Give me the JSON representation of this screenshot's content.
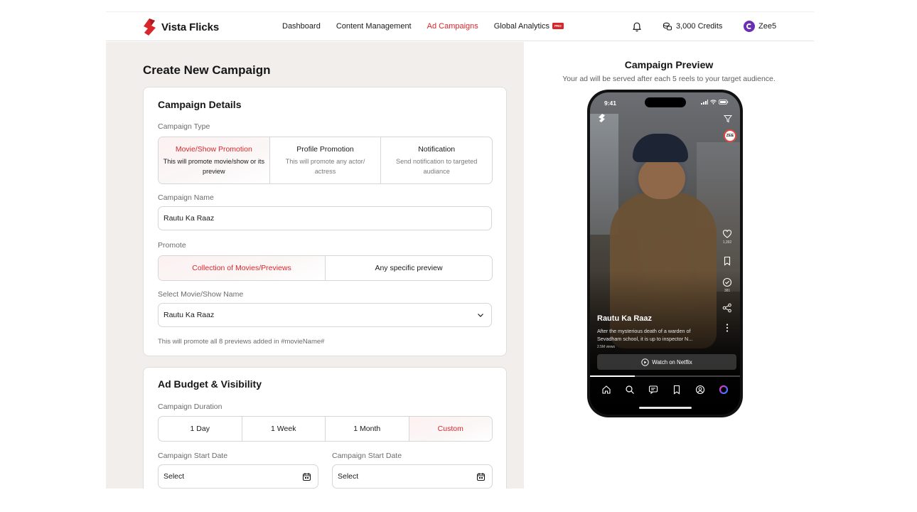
{
  "header": {
    "brand_name": "Vista Flicks",
    "nav": [
      "Dashboard",
      "Content Management",
      "Ad Campaigns",
      "Global Analytics"
    ],
    "active_nav": "Ad Campaigns",
    "pro_badge": "PRO",
    "credits": "3,000 Credits",
    "user_name": "Zee5"
  },
  "page_title": "Create New Campaign",
  "campaign_details": {
    "title": "Campaign Details",
    "type_label": "Campaign Type",
    "types": [
      {
        "title": "Movie/Show Promotion",
        "desc": "This will promote movie/show or its preview",
        "selected": true
      },
      {
        "title": "Profile Promotion",
        "desc": "This will promote any actor/ actress",
        "selected": false
      },
      {
        "title": "Notification",
        "desc": "Send notification to targeted audiance",
        "selected": false
      }
    ],
    "name_label": "Campaign Name",
    "name_value": "Rautu Ka Raaz",
    "promote_label": "Promote",
    "promote_options": [
      "Collection of Movies/Previews",
      "Any specific preview"
    ],
    "promote_selected": 0,
    "select_label": "Select Movie/Show Name",
    "select_value": "Rautu Ka Raaz",
    "helper": "This will promote all 8 previews added in #movieName#"
  },
  "budget": {
    "title": "Ad Budget & Visibility",
    "duration_label": "Campaign Duration",
    "durations": [
      "1 Day",
      "1 Week",
      "1 Month",
      "Custom"
    ],
    "duration_selected": 3,
    "start_label_1": "Campaign Start Date",
    "start_label_2": "Campaign Start Date",
    "start_value_1": "Select",
    "start_value_2": "Select"
  },
  "preview": {
    "title": "Campaign Preview",
    "subtitle": "Your ad will be served after each 5 reels to your target audience.",
    "time": "9:41",
    "zee_chip": "ZEE",
    "likes": "1,392",
    "checks": "381",
    "video_title": "Rautu Ka Raaz",
    "video_desc": "After the mysterious death of a warden of Sevadham school, it is up to inspector N...",
    "views": "2.5M views",
    "watch_label": "Watch on Netflix",
    "progress": 0.3
  },
  "colors": {
    "accent": "#d9262b",
    "panel_bg": "#f1eeec"
  }
}
